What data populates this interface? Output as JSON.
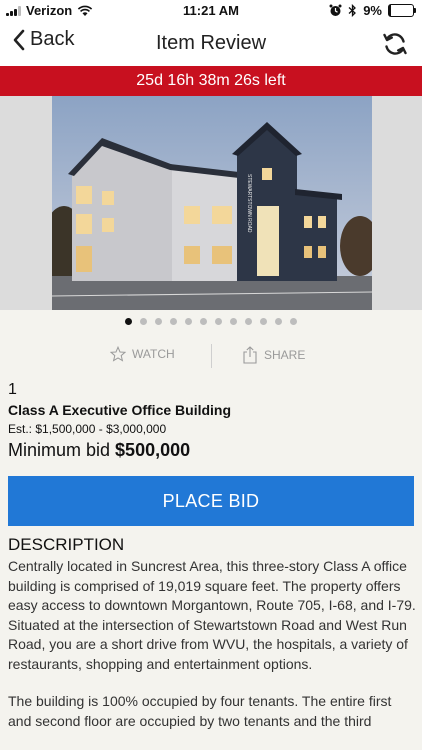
{
  "status_bar": {
    "carrier": "Verizon",
    "time": "11:21 AM",
    "battery_percent": "9%",
    "battery_level": 0.09,
    "icons": [
      "signal-icon",
      "wifi-icon",
      "alarm-icon",
      "bluetooth-icon",
      "battery-icon"
    ]
  },
  "nav": {
    "back_label": "Back",
    "title": "Item Review",
    "refresh_icon": "refresh-icon"
  },
  "timer": {
    "text": "25d 16h 38m 26s left"
  },
  "gallery": {
    "photo_count": 12,
    "active_index": 0,
    "building_sign": "STEWARTSTOWN ROAD"
  },
  "actions": {
    "watch_label": "WATCH",
    "share_label": "SHARE"
  },
  "item": {
    "lot_number": "1",
    "title": "Class A Executive Office Building",
    "estimate": "Est.: $1,500,000 - $3,000,000",
    "min_bid_label": "Minimum bid",
    "min_bid_value": "$500,000"
  },
  "place_bid_label": "PLACE BID",
  "description": {
    "heading": "DESCRIPTION",
    "paragraphs": [
      "Centrally located in Suncrest Area, this three-story Class A office building is comprised of 19,019 square feet. The property offers easy access to downtown Morgantown, Route 705, I-68, and I-79. Situated at the intersection of Stewartstown Road and West Run Road, you are a short drive from WVU, the hospitals, a variety of restaurants, shopping and entertainment options.",
      "The building is 100% occupied by four tenants. The entire first and second floor are occupied by two tenants and the third"
    ]
  },
  "colors": {
    "timer_bg": "#c8101f",
    "bid_button": "#2178d6",
    "page_bg": "#f4f3ee"
  }
}
